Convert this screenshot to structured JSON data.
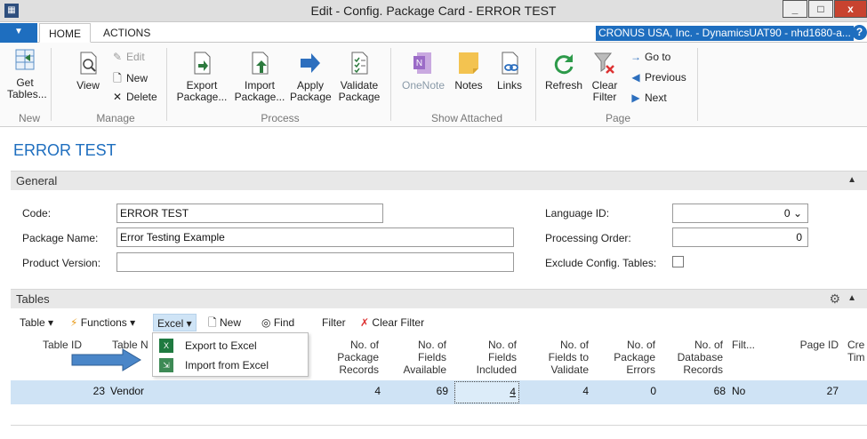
{
  "window": {
    "title": "Edit - Config. Package Card - ERROR TEST",
    "min": "_",
    "max": "□",
    "close": "x"
  },
  "ribbon_tabs": {
    "file_arrow": "▼",
    "home": "HOME",
    "actions": "ACTIONS",
    "company": "CRONUS USA, Inc. - DynamicsUAT90 - nhd1680-a...",
    "help": "?"
  },
  "ribbon": {
    "get_tables": "Get Tables...",
    "view": "View",
    "edit": "Edit",
    "new": "New",
    "delete": "Delete",
    "export_package": "Export Package...",
    "import_package": "Import Package...",
    "apply_package": "Apply Package",
    "validate_package": "Validate Package",
    "onenote": "OneNote",
    "notes": "Notes",
    "links": "Links",
    "refresh": "Refresh",
    "clear_filter": "Clear Filter",
    "go_to": "Go to",
    "previous": "Previous",
    "next": "Next",
    "groups": {
      "new": "New",
      "manage": "Manage",
      "process": "Process",
      "show_attached": "Show Attached",
      "page": "Page"
    }
  },
  "page_title": "ERROR TEST",
  "general": {
    "title": "General",
    "code_label": "Code:",
    "code_value": "ERROR TEST",
    "package_name_label": "Package Name:",
    "package_name_value": "Error Testing Example",
    "product_version_label": "Product Version:",
    "product_version_value": "",
    "language_id_label": "Language ID:",
    "language_id_value": "0",
    "processing_order_label": "Processing Order:",
    "processing_order_value": "0",
    "exclude_label": "Exclude Config. Tables:",
    "exclude_checked": false
  },
  "tables": {
    "title": "Tables",
    "toolbar": {
      "table": "Table",
      "functions": "Functions",
      "excel": "Excel",
      "new": "New",
      "find": "Find",
      "filter": "Filter",
      "clear_filter": "Clear Filter"
    },
    "columns": {
      "table_id": "Table ID",
      "table_name": "Table N",
      "pkg_records": [
        "No. of",
        "Package",
        "Records"
      ],
      "fields_available": [
        "No. of",
        "Fields",
        "Available"
      ],
      "fields_included": [
        "No. of",
        "Fields",
        "Included"
      ],
      "fields_validate": [
        "No. of",
        "Fields to",
        "Validate"
      ],
      "pkg_errors": [
        "No. of",
        "Package",
        "Errors"
      ],
      "db_records": [
        "No. of",
        "Database",
        "Records"
      ],
      "filt": "Filt...",
      "page_id": "Page ID",
      "cre": [
        "Cre",
        "Tim"
      ]
    },
    "rows": [
      {
        "table_id": "23",
        "table_name": "Vendor",
        "pkg_records": "4",
        "fields_available": "69",
        "fields_included": "4",
        "fields_validate": "4",
        "pkg_errors": "0",
        "db_records": "68",
        "filt": "No",
        "page_id": "27"
      }
    ],
    "excel_menu": [
      {
        "label": "Export to Excel"
      },
      {
        "label": "Import from Excel"
      }
    ]
  },
  "colors": {
    "accent": "#1e6ebf",
    "selected_row": "#cfe3f5",
    "arrow": "#4a86c8"
  }
}
